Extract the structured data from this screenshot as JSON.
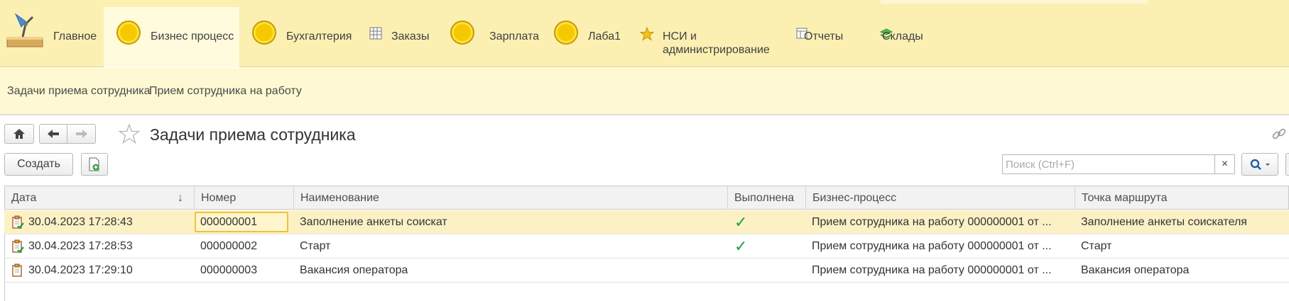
{
  "sections": [
    {
      "label": "Главное",
      "icon": "desk-lamp-icon"
    },
    {
      "label": "Бизнес процесс",
      "icon": "coin-icon",
      "active": true
    },
    {
      "label": "Бухгалтерия",
      "icon": "coin-icon"
    },
    {
      "label": "Заказы",
      "icon": "table-grid-icon"
    },
    {
      "label": "Зарплата",
      "icon": "coin-icon"
    },
    {
      "label": "Лаба1",
      "icon": "coin-icon"
    },
    {
      "label_line1": "НСИ и",
      "label_line2": "администрирование",
      "icon": "star-icon"
    },
    {
      "label": "Отчеты",
      "icon": "report-table-icon"
    },
    {
      "label": "Склады",
      "icon": "layers-icon"
    }
  ],
  "subpanel": {
    "links": [
      "Задачи приема сотрудника",
      "Прием сотрудника на работу"
    ]
  },
  "form": {
    "title": "Задачи приема сотрудника",
    "create_label": "Создать",
    "search_placeholder": "Поиск (Ctrl+F)",
    "search_clear": "×"
  },
  "table": {
    "columns": [
      "Дата",
      "Номер",
      "Наименование",
      "Выполнена",
      "Бизнес-процесс",
      "Точка маршрута"
    ],
    "sort_indicator": "↓",
    "rows": [
      {
        "date": "30.04.2023 17:28:43",
        "number": "000000001",
        "name": "Заполнение анкеты соискат",
        "done": true,
        "process": "Прием сотрудника на работу 000000001 от ...",
        "point": "Заполнение анкеты соискателя",
        "selected": true
      },
      {
        "date": "30.04.2023 17:28:53",
        "number": "000000002",
        "name": "Старт",
        "done": true,
        "process": "Прием сотрудника на работу 000000001 от ...",
        "point": "Старт",
        "selected": false
      },
      {
        "date": "30.04.2023 17:29:10",
        "number": "000000003",
        "name": "Вакансия оператора",
        "done": false,
        "process": "Прием сотрудника на работу 000000001 от ...",
        "point": "Вакансия оператора",
        "selected": false
      }
    ],
    "check_glyph": "✓"
  },
  "colors": {
    "accent_yellow": "#fbf0b2",
    "selected_row": "#fcf1c5",
    "check_green": "#19a04a",
    "search_blue": "#1f5fa8"
  }
}
